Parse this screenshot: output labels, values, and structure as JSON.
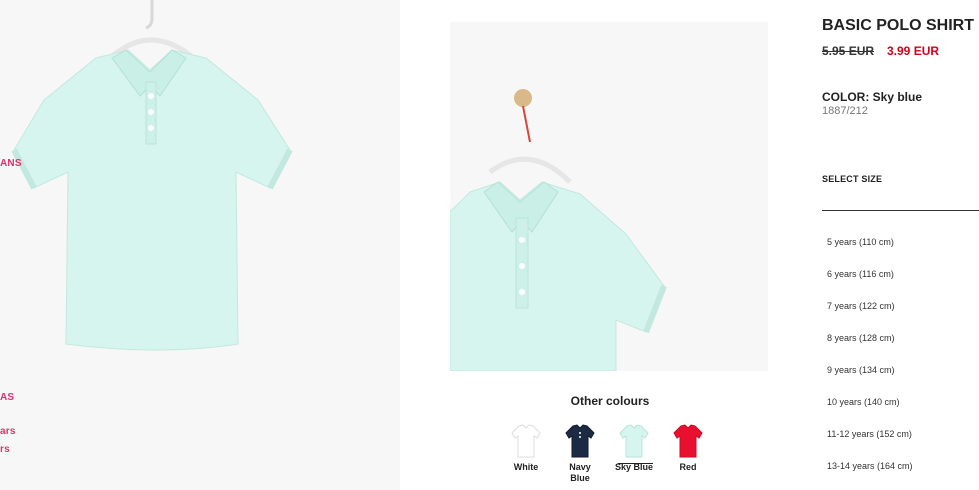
{
  "product": {
    "title": "BASIC POLO SHIRT",
    "old_price": "5.95 EUR",
    "new_price": "3.99 EUR",
    "color_label": "COLOR: Sky blue",
    "sku": "1887/212"
  },
  "colors": {
    "accent_pink": "#e0306e",
    "sale_red": "#d0021b",
    "shirt_mint": "#d6f5ee"
  },
  "side_links": [
    "ANS",
    "AS",
    "ars",
    "rs"
  ],
  "other_colours": {
    "title": "Other colours",
    "items": [
      {
        "label": "White",
        "color": "#ffffff"
      },
      {
        "label": "Navy Blue",
        "color": "#1c2a44"
      },
      {
        "label": "Sky Blue",
        "color": "#d6f5ee",
        "selected": true
      },
      {
        "label": "Red",
        "color": "#e8102e"
      }
    ]
  },
  "sizes": {
    "label": "SELECT SIZE",
    "options": [
      "5 years (110 cm)",
      "6 years (116 cm)",
      "7 years (122 cm)",
      "8 years (128 cm)",
      "9 years (134 cm)",
      "10 years (140 cm)",
      "11-12 years (152 cm)",
      "13-14 years (164 cm)"
    ]
  }
}
